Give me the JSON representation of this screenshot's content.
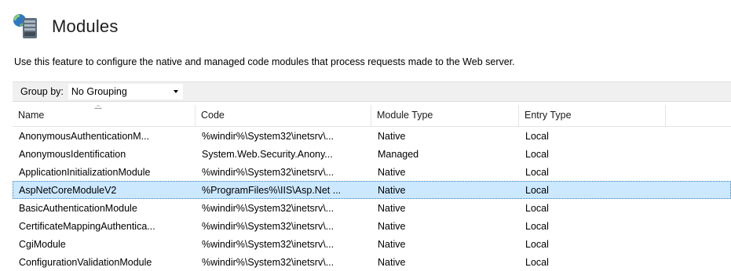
{
  "page": {
    "title": "Modules",
    "description": "Use this feature to configure the native and managed code modules that process requests made to the Web server."
  },
  "toolbar": {
    "group_by_label": "Group by:",
    "group_by_value": "No Grouping"
  },
  "table": {
    "columns": [
      "Name",
      "Code",
      "Module Type",
      "Entry Type"
    ],
    "rows": [
      {
        "name": "AnonymousAuthenticationM...",
        "code": "%windir%\\System32\\inetsrv\\...",
        "module_type": "Native",
        "entry_type": "Local"
      },
      {
        "name": "AnonymousIdentification",
        "code": "System.Web.Security.Anony...",
        "module_type": "Managed",
        "entry_type": "Local"
      },
      {
        "name": "ApplicationInitializationModule",
        "code": "%windir%\\System32\\inetsrv\\...",
        "module_type": "Native",
        "entry_type": "Local"
      },
      {
        "name": "AspNetCoreModuleV2",
        "code": "%ProgramFiles%\\IIS\\Asp.Net ...",
        "module_type": "Native",
        "entry_type": "Local",
        "selected": true
      },
      {
        "name": "BasicAuthenticationModule",
        "code": "%windir%\\System32\\inetsrv\\...",
        "module_type": "Native",
        "entry_type": "Local"
      },
      {
        "name": "CertificateMappingAuthentica...",
        "code": "%windir%\\System32\\inetsrv\\...",
        "module_type": "Native",
        "entry_type": "Local"
      },
      {
        "name": "CgiModule",
        "code": "%windir%\\System32\\inetsrv\\...",
        "module_type": "Native",
        "entry_type": "Local"
      },
      {
        "name": "ConfigurationValidationModule",
        "code": "%windir%\\System32\\inetsrv\\...",
        "module_type": "Native",
        "entry_type": "Local"
      }
    ]
  },
  "colors": {
    "selected_row": "#cce8ff",
    "selected_border": "#3c7fb1",
    "toolbar_bg": "#f0f0f0"
  },
  "icons": {
    "header": "modules-icon",
    "sort": "sort-ascending-icon",
    "dropdown": "chevron-down-icon"
  }
}
